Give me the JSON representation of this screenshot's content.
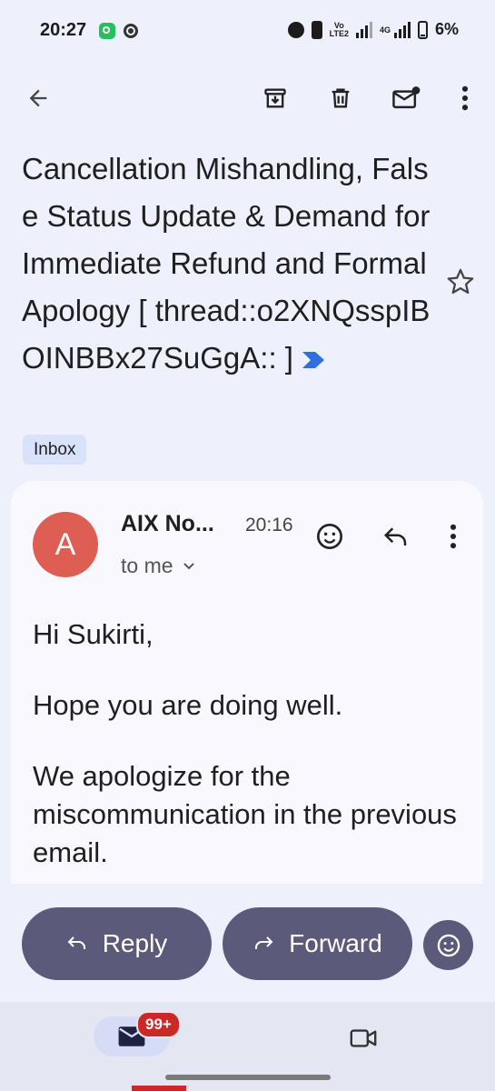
{
  "status_bar": {
    "time": "20:27",
    "volte_top": "Vo",
    "volte_bottom": "LTE2",
    "network": "4G",
    "battery": "6%"
  },
  "app_bar": {
    "icons": [
      "back-arrow-icon",
      "archive-icon",
      "trash-icon",
      "mark-unread-icon",
      "more-vert-icon"
    ]
  },
  "email": {
    "subject": "Cancellation Mishandling, False Status Update & Demand for Immediate Refund and Formal Apology [ thread::o2XNQsspIBOINBBx27SuGgA:: ]",
    "label": "Inbox",
    "sender_initial": "A",
    "sender": "AIX No...",
    "time": "20:16",
    "recipient": "to me",
    "body": [
      "Hi Sukirti,",
      "Hope you are doing well.",
      "We apologize for the miscommunication in the previous email."
    ]
  },
  "actions": {
    "reply": "Reply",
    "forward": "Forward"
  },
  "bottom_nav": {
    "mail_badge": "99+"
  },
  "colors": {
    "background": "#eef0fb",
    "avatar": "#df5e53",
    "pill": "#5b5a7a",
    "badge": "#c92a25",
    "label_chip": "#d8e2fb",
    "important_marker": "#2f6fe0"
  }
}
